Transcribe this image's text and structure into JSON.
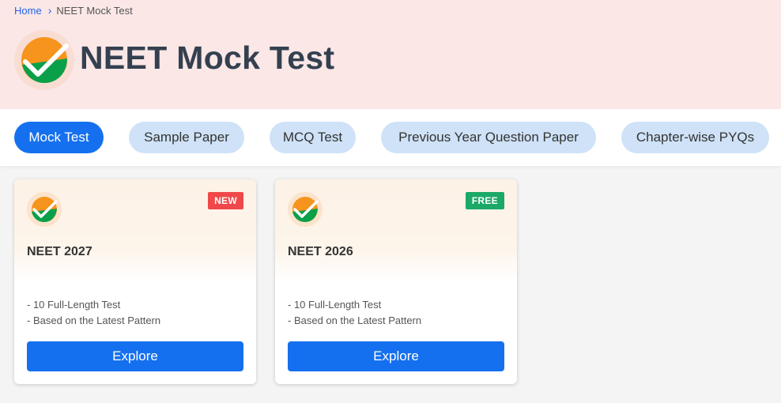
{
  "breadcrumb": {
    "home": "Home",
    "separator": "›",
    "current": "NEET Mock Test"
  },
  "hero": {
    "title": "NEET Mock Test",
    "logo_icon": "checkmark-logo-icon"
  },
  "tabs": [
    {
      "label": "Mock Test",
      "active": true
    },
    {
      "label": "Sample Paper",
      "active": false
    },
    {
      "label": "MCQ Test",
      "active": false
    },
    {
      "label": "Previous Year Question Paper",
      "active": false
    },
    {
      "label": "Chapter-wise PYQs",
      "active": false
    }
  ],
  "cards": [
    {
      "title": "NEET 2027",
      "badge": "NEW",
      "badge_color": "#f0484a",
      "features": [
        "- 10 Full-Length Test",
        "- Based on the Latest Pattern"
      ],
      "button": "Explore"
    },
    {
      "title": "NEET 2026",
      "badge": "FREE",
      "badge_color": "#1ca968",
      "features": [
        "- 10 Full-Length Test",
        "- Based on the Latest Pattern"
      ],
      "button": "Explore"
    }
  ],
  "colors": {
    "hero_bg": "#fae7e6",
    "accent": "#1570ef",
    "tab_inactive": "#cfe2f7",
    "logo_orange": "#f7941d",
    "logo_green": "#0aa04a"
  }
}
